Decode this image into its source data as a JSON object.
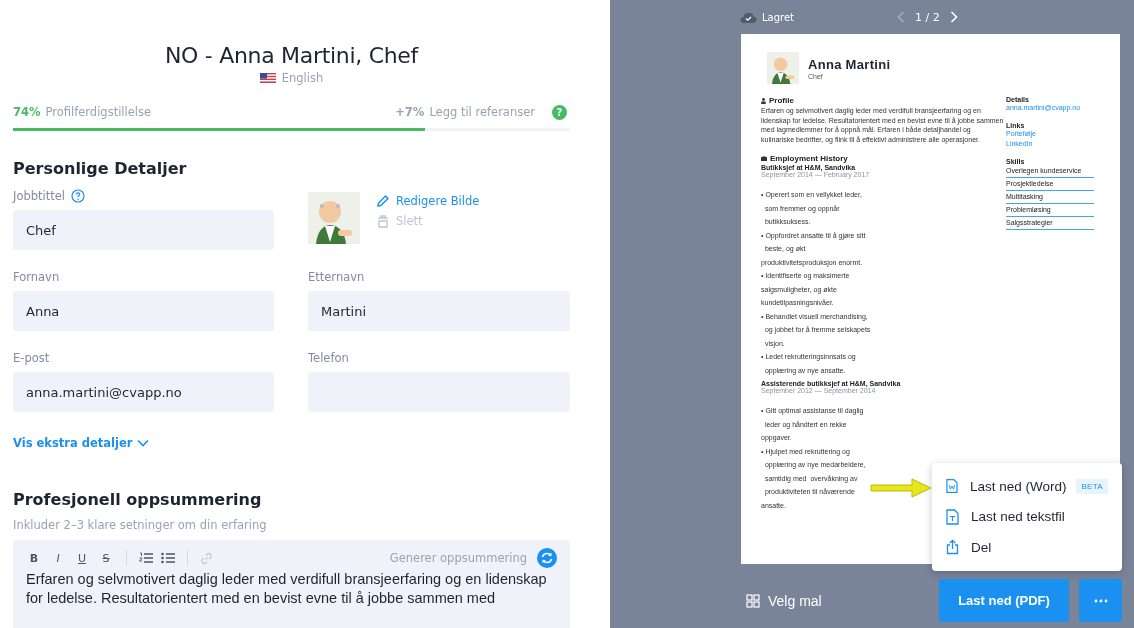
{
  "title": "NO - Anna Martini, Chef",
  "language": "English",
  "progress": {
    "percent": "74%",
    "label": "Profilferdigstillelse",
    "level": 0.74,
    "bonus": "+7%",
    "bonus_label": "Legg til referanser",
    "help": "?"
  },
  "personal": {
    "heading": "Personlige Detaljer",
    "fields": [
      {
        "label": "Jobbtittel",
        "value": "Chef",
        "help": true
      },
      {
        "actions": [
          {
            "label": "Redigere Bilde",
            "kind": "edit",
            "disabled": false
          },
          {
            "label": "Slett",
            "kind": "delete",
            "disabled": true
          }
        ]
      },
      {
        "label": "Fornavn",
        "value": "Anna",
        "help": false
      },
      {
        "label": "Etternavn",
        "value": "Martini",
        "help": false
      },
      {
        "label": "E-post",
        "value": "anna.martini@cvapp.no",
        "help": false
      },
      {
        "label": "Telefon",
        "help": false
      }
    ],
    "more_link": "Vis ekstra detaljer"
  },
  "summary": {
    "heading": "Profesjonell oppsummering",
    "hint": "Inkluder 2–3 klare setninger om din erfaring",
    "format_buttons": [
      {
        "label": "B",
        "kind": "bold"
      },
      {
        "label": "I",
        "kind": "italic"
      },
      {
        "label": "U",
        "kind": "underline"
      },
      {
        "label": "S",
        "kind": "strike"
      }
    ],
    "generate": "Generer oppsummering",
    "text": " Erfaren og selvmotivert daglig leder med verdifull bransjeerfaring og en lidenskap for ledelse.  Resultatorientert med en bevist evne til å jobbe sammen med"
  },
  "preview": {
    "status": "Lagret",
    "pager": {
      "text": "1 / 2",
      "prev_disabled": true,
      "next_disabled": false
    },
    "resume": {
      "name": "Anna  Martini",
      "title": "Chef",
      "profile": {
        "heading": "Profile",
        "text": " Erfaren og selvmotivert daglig leder med verdifull bransjeerfaring og en lidenskap for ledelse.  Resultatorientert med en bevist evne til å jobbe sammen med lagmedlemmer for å oppnå mål.  Erfaren i både detaljhandel og kulinariske bedrifter, og flink til å effektivt administrere alle operasjoner."
      },
      "employment": {
        "heading": "Employment History",
        "jobs": [
          {
            "title": "Butikksjef at  H&M, Sandvika",
            "dates": "September 2014 — February 2017",
            "lines": [
              "• Operert som en vellykket leder,",
              "  som fremmer og oppnår",
              "  butikksuksess.",
              "• Oppfordret ansatte til å gjøre sitt",
              "  beste, og økt",
              "produktivitetsproduksjon enormt.",
              "• Identifiserte og maksimerte",
              "salgsmuligheter, og økte",
              "kundetilpasningsnivåer.",
              "• Behandlet visuell merchandising,",
              "  og jobbet for å fremme selskapets",
              "  visjon.",
              "• Ledet rekrutteringsinnsats og",
              "  opplæring av nye ansatte."
            ]
          },
          {
            "title": "Assisterende butikksjef at  H&M, Sandvika",
            "dates": "September 2012 — September 2014",
            "lines": [
              "• Gitt optimal assistanse til daglig",
              "  leder og håndtert en rekke",
              "oppgaver.",
              "• Hjulpet med rekruttering og",
              "  opplæring av nye medarbeidere,",
              "  samtidig med  overvåkning av",
              "  produktiviteten til nåværende",
              "ansatte."
            ]
          }
        ]
      },
      "details": {
        "heading": "Details",
        "email": "anna.martini@cvapp.no"
      },
      "links": {
        "heading": "Links",
        "items": [
          "Portefølje",
          "LinkedIn"
        ]
      },
      "skills": {
        "heading": "Skills",
        "items": [
          "Overlegen kundeservice",
          "Prosjektledelse",
          "Multitasking",
          "Problemløsing",
          "Salgsstrategier"
        ]
      }
    },
    "menu": [
      {
        "label": "Last ned (Word)",
        "kind": "word",
        "badge": "BETA"
      },
      {
        "label": "Last ned tekstfil",
        "kind": "text"
      },
      {
        "label": "Del",
        "kind": "share"
      }
    ],
    "template_button": "Velg mal",
    "download_button": "Last ned (PDF)"
  }
}
